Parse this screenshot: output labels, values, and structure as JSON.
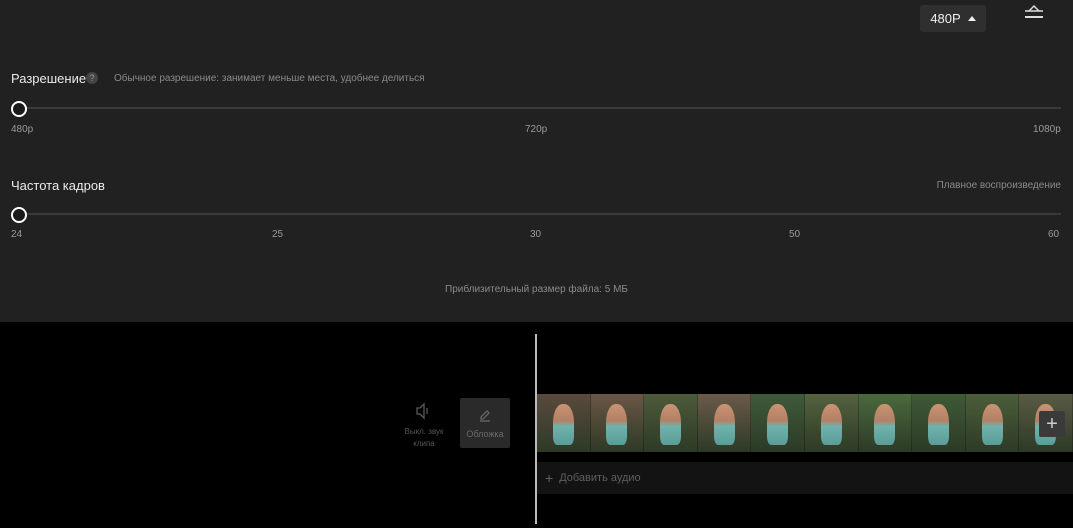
{
  "top_bar": {
    "resolution_button": "480P"
  },
  "resolution": {
    "label": "Разрешение",
    "help": "?",
    "hint": "Обычное разрешение: занимает меньше места, удобнее делиться",
    "value": "480p",
    "ticks": [
      "480p",
      "720p",
      "1080p"
    ]
  },
  "framerate": {
    "label": "Частота кадров",
    "hint": "Плавное воспроизведение",
    "value": "24",
    "ticks": [
      "24",
      "25",
      "30",
      "50",
      "60"
    ]
  },
  "file_size": "Приблизительный размер файла: 5 МБ",
  "timeline": {
    "sound_label_1": "Выкл. звук",
    "sound_label_2": "клипа",
    "cover_label": "Обложка",
    "add_audio": "Добавить аудио",
    "add_clip": "+",
    "frame_count": 10
  }
}
